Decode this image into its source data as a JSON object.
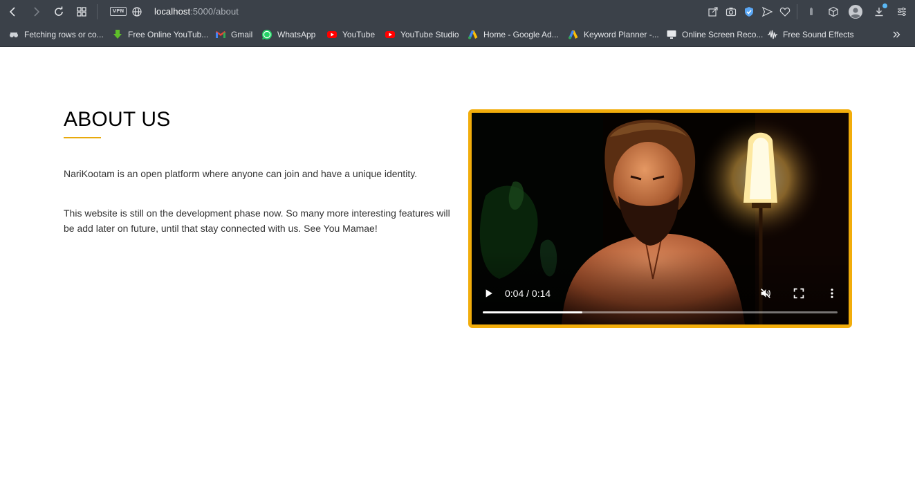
{
  "browser": {
    "url_host": "localhost",
    "url_path": ":5000/about",
    "vpn_label": "VPN",
    "bookmarks": [
      {
        "label": "Fetching rows or co...",
        "icon": "bookmark-favicon-icon"
      },
      {
        "label": "Free Online YouTub...",
        "icon": "download-arrow-icon"
      },
      {
        "label": "Gmail",
        "icon": "gmail-icon"
      },
      {
        "label": "WhatsApp",
        "icon": "whatsapp-icon"
      },
      {
        "label": "YouTube",
        "icon": "youtube-icon"
      },
      {
        "label": "YouTube Studio",
        "icon": "youtube-icon"
      },
      {
        "label": "Home - Google Ad...",
        "icon": "google-ads-icon"
      },
      {
        "label": "Keyword Planner -...",
        "icon": "google-ads-icon"
      },
      {
        "label": "Online Screen Reco...",
        "icon": "screen-recorder-icon"
      },
      {
        "label": "Free Sound Effects",
        "icon": "soundwave-icon"
      }
    ],
    "more_bookmarks_icon": "chevron-double-right-icon"
  },
  "page": {
    "title": "ABOUT US",
    "paragraph_1": "NariKootam is an open platform where anyone can join and have a unique identity.",
    "paragraph_2": "This website is still on the development phase now. So many more interesting features will be add later on future, until that stay connected with us. See You Mamae!",
    "accent_color": "#f2ad0b"
  },
  "video": {
    "current_time": "0:04",
    "duration": "0:14",
    "time_display": "0:04 / 0:14",
    "progress_fraction": 0.28,
    "muted": true
  }
}
